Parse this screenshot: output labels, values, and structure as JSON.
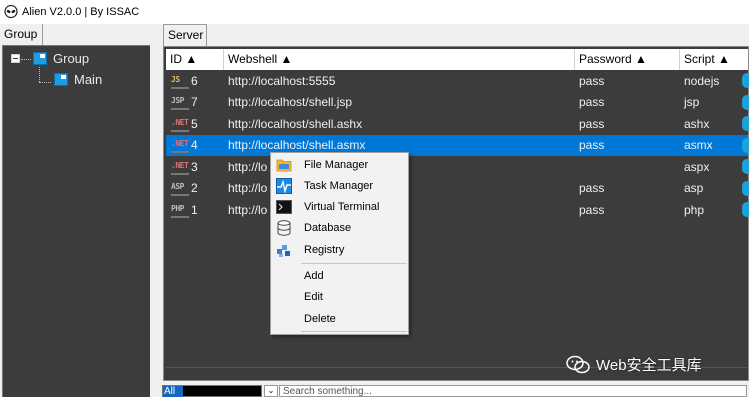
{
  "window": {
    "title": "Alien V2.0.0 | By ISSAC",
    "icon": "alien-icon"
  },
  "group_panel": {
    "tab_label": "Group",
    "tree": [
      {
        "label": "Group",
        "icon": "folder-icon"
      },
      {
        "label": "Main",
        "icon": "folder-icon"
      }
    ]
  },
  "server_panel": {
    "tab_label": "Server",
    "columns": [
      "ID ▲",
      "Webshell ▲",
      "Password ▲",
      "Script ▲"
    ],
    "rows": [
      {
        "type_icon": "JS",
        "id": "6",
        "webshell": "http://localhost:5555",
        "password": "pass",
        "script": "nodejs",
        "selected": false
      },
      {
        "type_icon": "JSP",
        "id": "7",
        "webshell": "http://localhost/shell.jsp",
        "password": "pass",
        "script": "jsp",
        "selected": false
      },
      {
        "type_icon": ".NET",
        "id": "5",
        "webshell": "http://localhost/shell.ashx",
        "password": "pass",
        "script": "ashx",
        "selected": false
      },
      {
        "type_icon": ".NET",
        "id": "4",
        "webshell": "http://localhost/shell.asmx",
        "password": "pass",
        "script": "asmx",
        "selected": true
      },
      {
        "type_icon": ".NET",
        "id": "3",
        "webshell": "http://lo",
        "password": "",
        "script": "aspx",
        "selected": false
      },
      {
        "type_icon": "ASP",
        "id": "2",
        "webshell": "http://lo",
        "password": "pass",
        "script": "asp",
        "selected": false
      },
      {
        "type_icon": "PHP",
        "id": "1",
        "webshell": "http://lo",
        "password": "pass",
        "script": "php",
        "selected": false
      }
    ]
  },
  "context_menu": {
    "items": [
      {
        "label": "File Manager",
        "icon": "folder-open-icon"
      },
      {
        "label": "Task Manager",
        "icon": "activity-icon"
      },
      {
        "label": "Virtual Terminal",
        "icon": "terminal-icon"
      },
      {
        "label": "Database",
        "icon": "database-icon"
      },
      {
        "label": "Registry",
        "icon": "registry-icon"
      }
    ],
    "actions": [
      "Add",
      "Edit",
      "Delete"
    ]
  },
  "bottom_bar": {
    "filter_value": "All",
    "search_placeholder": "Search something..."
  },
  "watermark": {
    "text": "Web安全工具库",
    "icon": "wechat-icon"
  },
  "colors": {
    "selection": "#0078d7",
    "grid_background": "#3c3c3c",
    "folder": "#1f9be3"
  }
}
